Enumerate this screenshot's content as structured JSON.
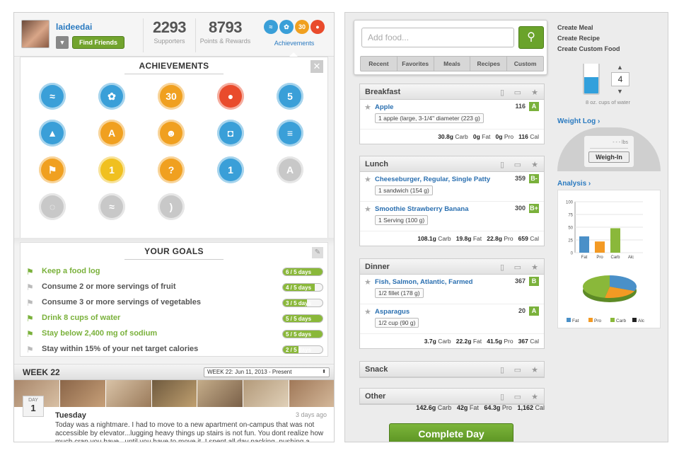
{
  "profile": {
    "username": "laideedai",
    "find_friends": "Find Friends",
    "supporters_count": "2293",
    "supporters_label": "Supporters",
    "points_count": "8793",
    "points_label": "Points & Rewards",
    "achievements_label": "Achievements",
    "mini_badges": [
      "30"
    ]
  },
  "achievements": {
    "title": "ACHIEVEMENTS",
    "badges": [
      {
        "name": "wave-badge-icon",
        "color": "#3a9fd8",
        "glyph": "≈"
      },
      {
        "name": "feet-badge-icon",
        "color": "#3a9fd8",
        "glyph": "✿"
      },
      {
        "name": "thirty-badge-icon",
        "color": "#f0a020",
        "glyph": "30"
      },
      {
        "name": "apple-badge-icon",
        "color": "#e94b2c",
        "glyph": "●"
      },
      {
        "name": "five-badge-icon",
        "color": "#3a9fd8",
        "glyph": "5"
      },
      {
        "name": "graduation-badge-icon",
        "color": "#3a9fd8",
        "glyph": "▲"
      },
      {
        "name": "a-grade-badge-icon",
        "color": "#f0a020",
        "glyph": "A"
      },
      {
        "name": "character-badge-icon",
        "color": "#f0a020",
        "glyph": "☻"
      },
      {
        "name": "camera-badge-icon",
        "color": "#3a9fd8",
        "glyph": "◘"
      },
      {
        "name": "dumbbell-badge-icon",
        "color": "#3a9fd8",
        "glyph": "≡"
      },
      {
        "name": "checkered-flag-badge-icon",
        "color": "#f0a020",
        "glyph": "⚑"
      },
      {
        "name": "trophy-badge-icon",
        "color": "#f0c020",
        "glyph": "1"
      },
      {
        "name": "question-badge-icon",
        "color": "#f0a020",
        "glyph": "?"
      },
      {
        "name": "first-badge-icon",
        "color": "#3a9fd8",
        "glyph": "1"
      },
      {
        "name": "locked-a-badge-icon",
        "color": "#c8c8c8",
        "glyph": "A"
      },
      {
        "name": "locked-sneaker-badge-icon",
        "color": "#c8c8c8",
        "glyph": "◌"
      },
      {
        "name": "locked-wave-badge-icon",
        "color": "#c8c8c8",
        "glyph": "≈"
      },
      {
        "name": "locked-banana-badge-icon",
        "color": "#c8c8c8",
        "glyph": ")"
      }
    ]
  },
  "goals": {
    "title": "YOUR GOALS",
    "items": [
      {
        "text": "Keep a food log",
        "done": true,
        "progress": "6 / 5 days",
        "fraction": 1.0
      },
      {
        "text": "Consume 2 or more servings of fruit",
        "done": false,
        "progress": "4 / 5 days",
        "fraction": 0.8
      },
      {
        "text": "Consume 3 or more servings of vegetables",
        "done": false,
        "progress": "3 / 5 days",
        "fraction": 0.6
      },
      {
        "text": "Drink 8 cups of water",
        "done": true,
        "progress": "5 / 5 days",
        "fraction": 1.0
      },
      {
        "text": "Stay below 2,400 mg of sodium",
        "done": true,
        "progress": "5 / 5 days",
        "fraction": 1.0
      },
      {
        "text": "Stay within 15% of your net target calories",
        "done": false,
        "progress": "2 / 5 days",
        "fraction": 0.4
      }
    ]
  },
  "week": {
    "title": "WEEK 22",
    "select": "WEEK 22: Jun 11, 2013 - Present",
    "day_label": "DAY",
    "day_num": "1",
    "entry_title": "Tuesday",
    "entry_ago": "3 days ago",
    "entry_body": "Today was a nightmare. I had to move to a new apartment on-campus that was not accessible by elevator...lugging heavy things up stairs is not fun. You dont realize how much crap you have...until you have to move it. I spent all day packing, pushing a cartload"
  },
  "log": {
    "search_placeholder": "Add food...",
    "tabs": [
      "Recent",
      "Favorites",
      "Meals",
      "Recipes",
      "Custom"
    ],
    "meals": [
      {
        "title": "Breakfast",
        "foods": [
          {
            "name": "Apple",
            "cal": "116",
            "grade": "A",
            "serving": "1 apple (large, 3-1/4\" diameter (223 g)"
          }
        ],
        "totals": {
          "carb": "30.8g",
          "fat": "0g",
          "pro": "0g",
          "cal": "116"
        }
      },
      {
        "title": "Lunch",
        "foods": [
          {
            "name": "Cheeseburger, Regular, Single Patty",
            "cal": "359",
            "grade": "B-",
            "serving": "1 sandwich (154 g)"
          },
          {
            "name": "Smoothie Strawberry Banana",
            "cal": "300",
            "grade": "B+",
            "serving": "1 Serving (100 g)"
          }
        ],
        "totals": {
          "carb": "108.1g",
          "fat": "19.8g",
          "pro": "22.8g",
          "cal": "659"
        }
      },
      {
        "title": "Dinner",
        "foods": [
          {
            "name": "Fish, Salmon, Atlantic, Farmed",
            "cal": "367",
            "grade": "B",
            "serving": "1/2 fillet (178 g)"
          },
          {
            "name": "Asparagus",
            "cal": "20",
            "grade": "A",
            "serving": "1/2 cup (90 g)"
          }
        ],
        "totals": {
          "carb": "3.7g",
          "fat": "22.2g",
          "pro": "41.5g",
          "cal": "367"
        }
      },
      {
        "title": "Snack",
        "foods": [],
        "totals": null
      },
      {
        "title": "Other",
        "foods": [],
        "totals": null
      }
    ],
    "unit_labels": {
      "carb": "Carb",
      "fat": "Fat",
      "pro": "Pro",
      "cal": "Cal"
    },
    "grand": {
      "carb": "142.6g",
      "fat": "42g",
      "pro": "64.3g",
      "cal": "1,162"
    },
    "complete_label": "Complete Day"
  },
  "sidebar": {
    "links": [
      "Create Meal",
      "Create Recipe",
      "Create Custom Food"
    ],
    "water_count": "4",
    "water_label": "8 oz. cups of water",
    "weight_log": "Weight Log",
    "lbs_value": "- - -",
    "lbs_unit": "lbs",
    "weigh_in": "Weigh-In",
    "analysis": "Analysis"
  },
  "chart_data": {
    "type": "bar",
    "categories": [
      "Fat",
      "Pro",
      "Carb",
      "Alc"
    ],
    "values": [
      32,
      22,
      48,
      0
    ],
    "ylim": [
      0,
      100
    ],
    "yticks": [
      0,
      25,
      50,
      75,
      100
    ],
    "colors": [
      "#4a90c8",
      "#f39a24",
      "#8ab83a",
      "#222222"
    ],
    "pie": {
      "values": [
        32,
        22,
        48,
        0
      ]
    },
    "legend": [
      "Fat",
      "Pro",
      "Carb",
      "Alc"
    ]
  }
}
